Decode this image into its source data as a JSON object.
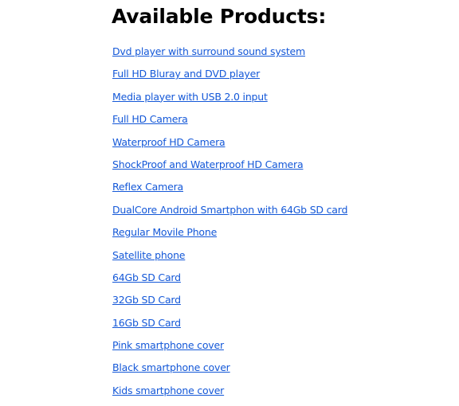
{
  "heading": "Available Products:",
  "link_color": "#1458d8",
  "products": [
    "Dvd player with surround sound system",
    "Full HD Bluray and DVD player",
    "Media player with USB 2.0 input",
    "Full HD Camera",
    "Waterproof HD Camera",
    "ShockProof and Waterproof HD Camera",
    "Reflex Camera",
    "DualCore Android Smartphon with 64Gb SD card",
    "Regular Movile Phone",
    "Satellite phone",
    "64Gb SD Card",
    "32Gb SD Card",
    "16Gb SD Card",
    "Pink smartphone cover",
    "Black smartphone cover",
    "Kids smartphone cover"
  ]
}
